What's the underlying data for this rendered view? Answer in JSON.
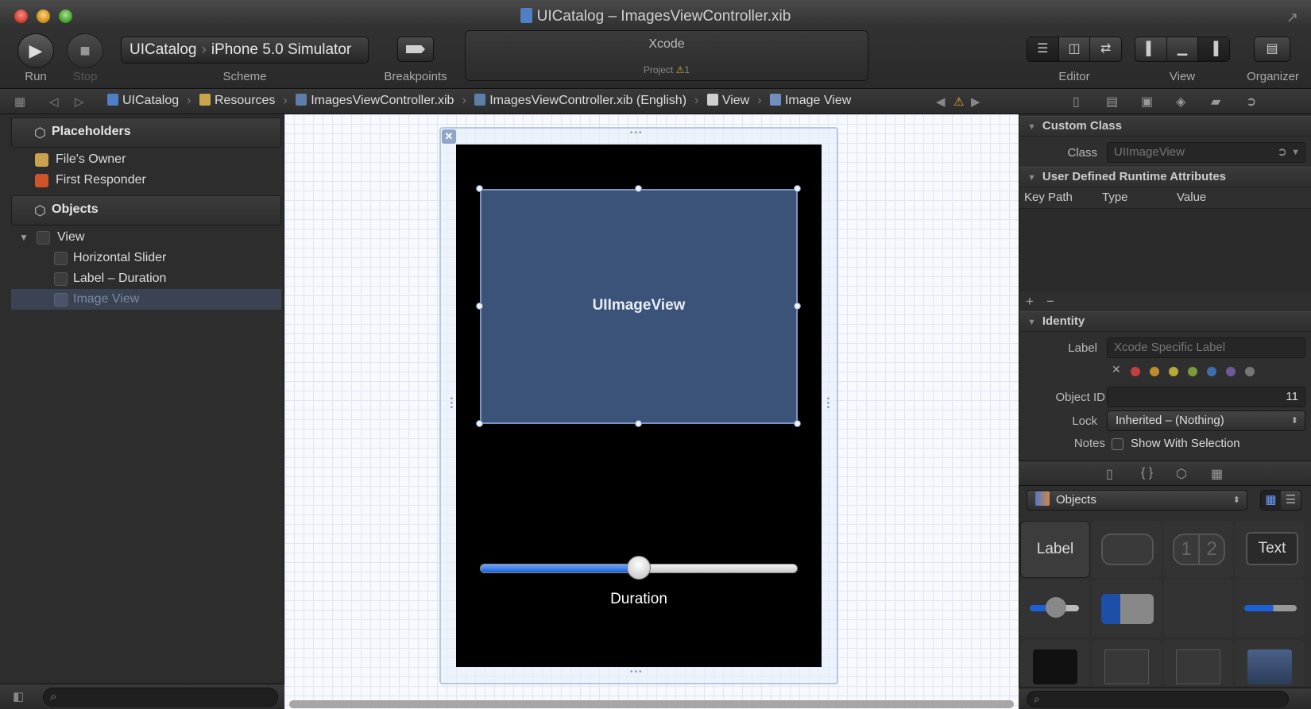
{
  "window": {
    "title": "UICatalog – ImagesViewController.xib",
    "fullscreen_icon": "↗"
  },
  "toolbar": {
    "run_label": "Run",
    "stop_label": "Stop",
    "scheme_label": "Scheme",
    "scheme_target": "UICatalog",
    "scheme_destination": "iPhone 5.0 Simulator",
    "breakpoints_label": "Breakpoints",
    "activity_title": "Xcode",
    "activity_status": "Project",
    "activity_warning_count": "1",
    "editor_label": "Editor",
    "view_label": "View",
    "organizer_label": "Organizer"
  },
  "jumpbar": {
    "crumbs": [
      "UICatalog",
      "Resources",
      "ImagesViewController.xib",
      "ImagesViewController.xib (English)",
      "View",
      "Image View"
    ]
  },
  "navigator": {
    "placeholders_header": "Placeholders",
    "files_owner": "File's Owner",
    "first_responder": "First Responder",
    "objects_header": "Objects",
    "view": "View",
    "horizontal_slider": "Horizontal Slider",
    "label_duration": "Label – Duration",
    "image_view": "Image View"
  },
  "canvas": {
    "image_view_label": "UIImageView",
    "duration_label": "Duration",
    "slider_value_fraction": 0.5
  },
  "inspector": {
    "custom_class_header": "Custom Class",
    "class_label": "Class",
    "class_placeholder": "UIImageView",
    "runtime_attrs_header": "User Defined Runtime Attributes",
    "col_key_path": "Key Path",
    "col_type": "Type",
    "col_value": "Value",
    "add_symbol": "+",
    "remove_symbol": "−",
    "identity_header": "Identity",
    "label_label": "Label",
    "label_placeholder": "Xcode Specific Label",
    "clear_color_symbol": "✕",
    "object_id_label": "Object ID",
    "object_id_value": "11",
    "lock_label": "Lock",
    "lock_value": "Inherited – (Nothing)",
    "notes_label": "Notes",
    "show_with_selection": "Show With Selection"
  },
  "library": {
    "popup_value": "Objects",
    "tile_label": "Label",
    "tile_segment_1": "1",
    "tile_segment_2": "2",
    "tile_text": "Text"
  },
  "colors": {
    "image_view_fill": "#3b5279",
    "slider_fill": "#1d5fd6",
    "selection_row": "#3b4352"
  }
}
